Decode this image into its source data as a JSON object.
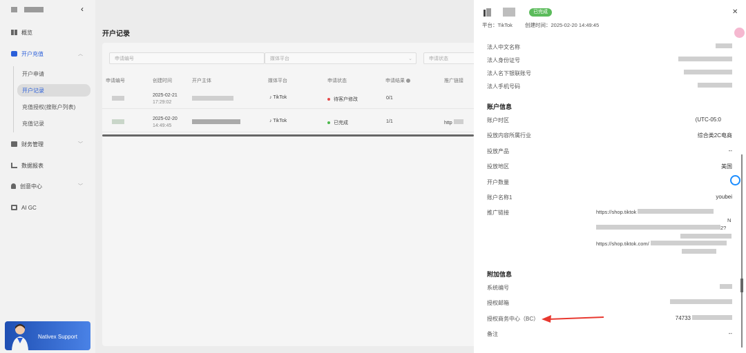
{
  "sidebar": {
    "items": [
      {
        "label": "概览"
      },
      {
        "label": "开户充值",
        "active": true
      },
      {
        "label": "财务管理"
      },
      {
        "label": "数据报表"
      },
      {
        "label": "创意中心"
      },
      {
        "label": "AI GC"
      }
    ],
    "sub_items": [
      {
        "label": "开户申请"
      },
      {
        "label": "开户记录",
        "active": true
      },
      {
        "label": "充值授权(搜账户列表)"
      },
      {
        "label": "充值记录"
      }
    ],
    "support": {
      "label": "Nativex Support"
    }
  },
  "main": {
    "title": "开户记录",
    "filters": {
      "app_no": "申请编号",
      "platform": "媒体平台",
      "status": "申请状态"
    },
    "columns": [
      "申请编号",
      "创建时间",
      "开户主体",
      "媒体平台",
      "申请状态",
      "申请结果",
      "推广链接"
    ],
    "rows": [
      {
        "date": "2025-02-21",
        "time": "17:29:02",
        "platform": "TikTok",
        "status": "待客户修改",
        "status_color": "#e64a4a",
        "result": "0/1",
        "link": ""
      },
      {
        "date": "2025-02-20",
        "time": "14:49:45",
        "platform": "TikTok",
        "status": "已完成",
        "status_color": "#4cb84c",
        "result": "1/1",
        "link": "http"
      }
    ]
  },
  "drawer": {
    "badge": "已完成",
    "platform_line": "平台：TikTok",
    "created_line": "创建时间：2025-02-20 14:49:45",
    "legal_fields": [
      {
        "label": "法人中文名称"
      },
      {
        "label": "法人身份证号"
      },
      {
        "label": "法人名下银联账号"
      },
      {
        "label": "法人手机号码"
      }
    ],
    "account_section": "账户信息",
    "account_fields": [
      {
        "label": "账户时区",
        "value": "(UTC-05:0"
      },
      {
        "label": "投放内容所属行业",
        "value": "综合类2C电商"
      },
      {
        "label": "投放产品",
        "value": "--"
      },
      {
        "label": "投放地区",
        "value": "美国"
      },
      {
        "label": "开户数量",
        "value": ""
      },
      {
        "label": "账户名称1",
        "value": "youbei"
      }
    ],
    "promo_label": "推广链接",
    "promo_links": [
      "https://shop.tiktok",
      "N",
      "2?",
      "https://shop.tiktok.com/"
    ],
    "extra_section": "附加信息",
    "extra_fields": [
      {
        "label": "系统编号",
        "value": ""
      },
      {
        "label": "授权邮箱",
        "value": ""
      },
      {
        "label": "授权商务中心（BC）",
        "value": "74733"
      },
      {
        "label": "备注",
        "value": "--"
      }
    ]
  },
  "colors": {
    "accent": "#2b5fd9",
    "success": "#5bbb5b",
    "danger": "#e64a4a",
    "arrow": "#e8382f"
  }
}
